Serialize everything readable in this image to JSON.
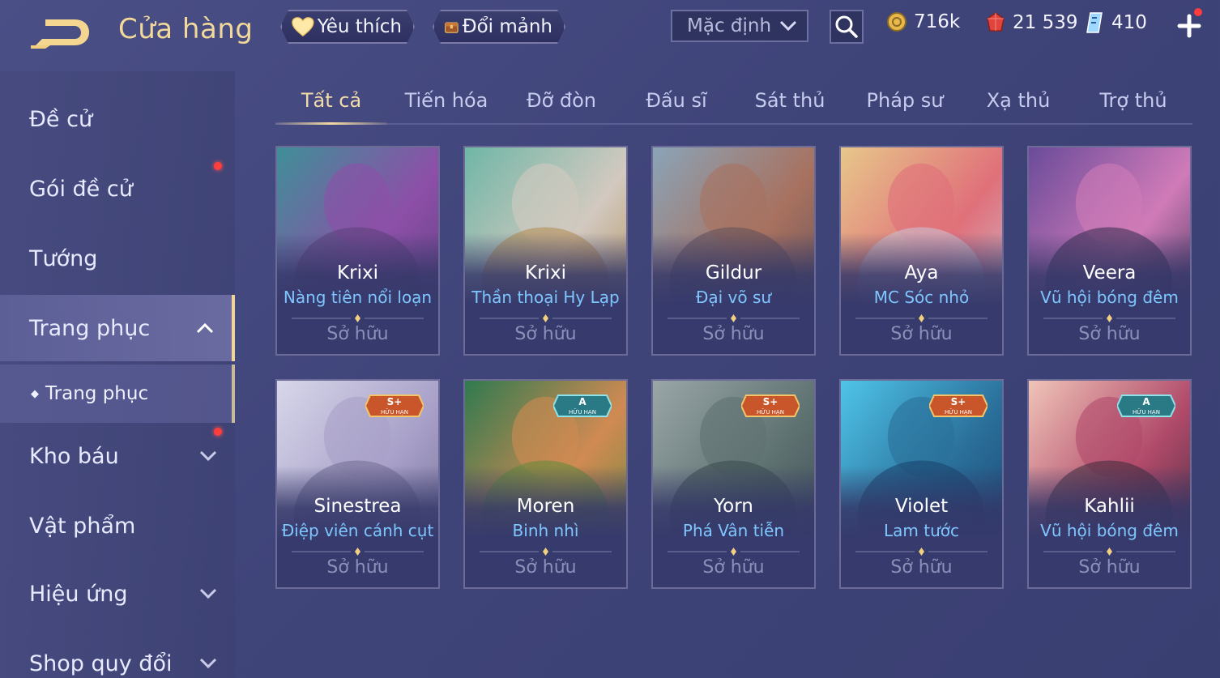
{
  "header": {
    "title": "Cửa hàng",
    "favorites_label": "Yêu thích",
    "fragments_label": "Đổi mảnh",
    "sort": {
      "selected": "Mặc định"
    },
    "currencies": [
      {
        "icon": "gold-coin-icon",
        "value": "716k"
      },
      {
        "icon": "ruby-icon",
        "value": "21 539"
      },
      {
        "icon": "voucher-gem-icon",
        "value": "410"
      }
    ]
  },
  "sidebar": {
    "items": [
      {
        "label": "Đề cử"
      },
      {
        "label": "Gói đề cử"
      },
      {
        "label": "Tướng"
      },
      {
        "label": "Trang phục"
      },
      {
        "label": "Kho báu"
      },
      {
        "label": "Vật phẩm"
      },
      {
        "label": "Hiệu ứng"
      },
      {
        "label": "Shop quy đổi"
      }
    ],
    "sub_item": {
      "label": "Trang phục"
    }
  },
  "tabs": [
    {
      "label": "Tất cả"
    },
    {
      "label": "Tiến hóa"
    },
    {
      "label": "Đỡ đòn"
    },
    {
      "label": "Đấu sĩ"
    },
    {
      "label": "Sát thủ"
    },
    {
      "label": "Pháp sư"
    },
    {
      "label": "Xạ thủ"
    },
    {
      "label": "Trợ thủ"
    }
  ],
  "cards": [
    {
      "hero": "Krixi",
      "skin": "Nàng tiên nổi loạn",
      "status": "Sở hữu",
      "badge": ""
    },
    {
      "hero": "Krixi",
      "skin": "Thần thoại Hy Lạp",
      "status": "Sở hữu",
      "badge": ""
    },
    {
      "hero": "Gildur",
      "skin": "Đại võ sư",
      "status": "Sở hữu",
      "badge": ""
    },
    {
      "hero": "Aya",
      "skin": "MC Sóc nhỏ",
      "status": "Sở hữu",
      "badge": ""
    },
    {
      "hero": "Veera",
      "skin": "Vũ hội bóng đêm",
      "status": "Sở hữu",
      "badge": ""
    },
    {
      "hero": "Sinestrea",
      "skin": "Điệp viên cánh cụt",
      "status": "Sở hữu",
      "badge": "S+",
      "badge_sub": "HỮU HẠN"
    },
    {
      "hero": "Moren",
      "skin": "Binh nhì",
      "status": "Sở hữu",
      "badge": "A",
      "badge_sub": "HỮU HẠN"
    },
    {
      "hero": "Yorn",
      "skin": "Phá Vân tiễn",
      "status": "Sở hữu",
      "badge": "S+",
      "badge_sub": "HỮU HẠN"
    },
    {
      "hero": "Violet",
      "skin": "Lam tước",
      "status": "Sở hữu",
      "badge": "S+",
      "badge_sub": "HỮU HẠN"
    },
    {
      "hero": "Kahlii",
      "skin": "Vũ hội bóng đêm",
      "status": "Sở hữu",
      "badge": "A",
      "badge_sub": "HỮU HẠN"
    }
  ],
  "colors": {
    "accent_gold": "#f2d99a",
    "skin_name_blue": "#7fc6ff",
    "notification_red": "#ff3b3b"
  }
}
